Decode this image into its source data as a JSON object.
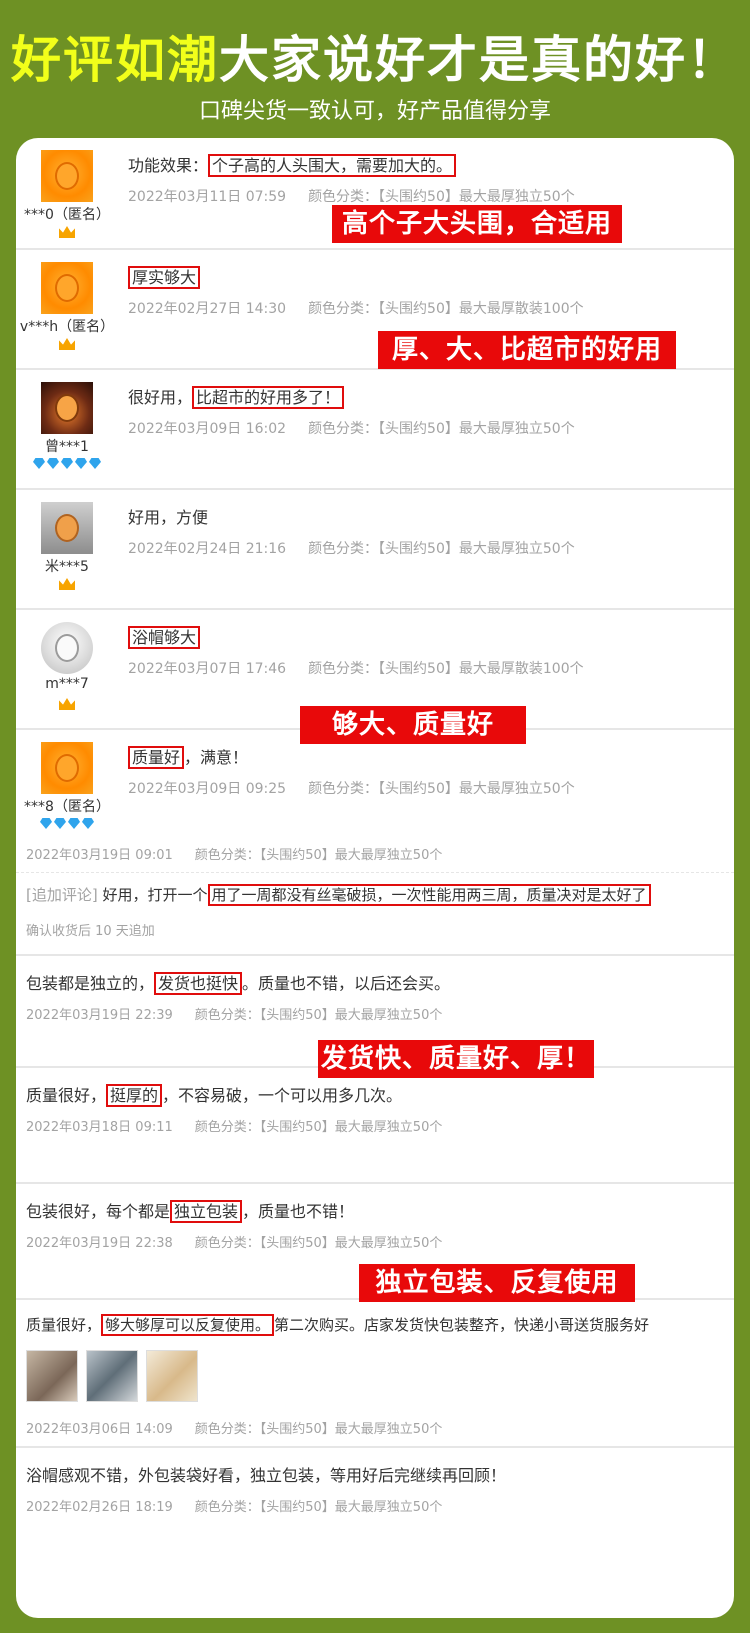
{
  "header": {
    "title_highlight": "好评如潮",
    "title_rest": "大家说好才是真的好！",
    "subtitle": "口碑尖货一致认可，好产品值得分享"
  },
  "colors": {
    "background": "#6e9124",
    "title_highlight": "#f2ff1a",
    "banner": "#e8090a",
    "box": "#e00d0d"
  },
  "reviews": [
    {
      "user": "***0（匿名）",
      "badge": "crown",
      "text_pre": "功能效果：",
      "text_boxed": "个子高的人头围大，需要加大的。",
      "text_post": "",
      "date": "2022年03月11日 07:59",
      "color": "颜色分类：【头围约50】最大最厚独立50个",
      "banner": "高个子大头围，合适用"
    },
    {
      "user": "v***h（匿名）",
      "badge": "crown",
      "text_pre": "",
      "text_boxed": "厚实够大",
      "text_post": "",
      "date": "2022年02月27日 14:30",
      "color": "颜色分类：【头围约50】最大最厚散装100个",
      "banner": "厚、大、比超市的好用"
    },
    {
      "user": "曾***1",
      "badge": "diamonds5",
      "text_pre": "很好用，",
      "text_boxed": "比超市的好用多了！",
      "text_post": "",
      "date": "2022年03月09日 16:02",
      "color": "颜色分类：【头围约50】最大最厚独立50个"
    },
    {
      "user": "米***5",
      "badge": "crown",
      "text_pre": "好用，方便",
      "text_boxed": "",
      "text_post": "",
      "date": "2022年02月24日 21:16",
      "color": "颜色分类：【头围约50】最大最厚独立50个"
    },
    {
      "user": "m***7",
      "badge": "crown",
      "text_pre": "",
      "text_boxed": "浴帽够大",
      "text_post": "",
      "date": "2022年03月07日 17:46",
      "color": "颜色分类：【头围约50】最大最厚散装100个",
      "banner": "够大、质量好"
    },
    {
      "user": "***8（匿名）",
      "badge": "diamonds4",
      "text_pre": "",
      "text_boxed": "质量好",
      "text_post": "，满意！",
      "date": "2022年03月09日 09:25",
      "color": "颜色分类：【头围约50】最大最厚独立50个"
    }
  ],
  "plain_reviews": [
    {
      "date": "2022年03月19日 09:01",
      "color": "颜色分类：【头围约50】最大最厚独立50个",
      "append_tag": "[追加评论]",
      "append_pre": "好用，打开一个",
      "append_boxed": "用了一周都没有丝毫破损，一次性能用两三周，质量决对是太好了",
      "append_note": "确认收货后 10 天追加"
    },
    {
      "text_pre": "包装都是独立的，",
      "text_boxed": "发货也挺快",
      "text_post": "。质量也不错，以后还会买。",
      "date": "2022年03月19日 22:39",
      "color": "颜色分类：【头围约50】最大最厚独立50个",
      "banner": "发货快、质量好、厚！"
    },
    {
      "text_pre": "质量很好，",
      "text_boxed": "挺厚的",
      "text_post": "，不容易破，一个可以用多几次。",
      "date": "2022年03月18日 09:11",
      "color": "颜色分类：【头围约50】最大最厚独立50个"
    },
    {
      "text_pre": "包装很好，每个都是",
      "text_boxed": "独立包装",
      "text_post": "，质量也不错！",
      "date": "2022年03月19日 22:38",
      "color": "颜色分类：【头围约50】最大最厚独立50个",
      "banner": "独立包装、反复使用"
    },
    {
      "text_pre": "质量很好，",
      "text_boxed": "够大够厚可以反复使用。",
      "text_post": "第二次购买。店家发货快包装整齐，快递小哥送货服务好",
      "date": "2022年03月06日 14:09",
      "color": "颜色分类：【头围约50】最大最厚独立50个"
    },
    {
      "text_pre": "浴帽感观不错，外包装袋好看，独立包装，等用好后完继续再回顾！",
      "text_boxed": "",
      "text_post": "",
      "date": "2022年02月26日 18:19",
      "color": "颜色分类：【头围约50】最大最厚独立50个"
    }
  ]
}
